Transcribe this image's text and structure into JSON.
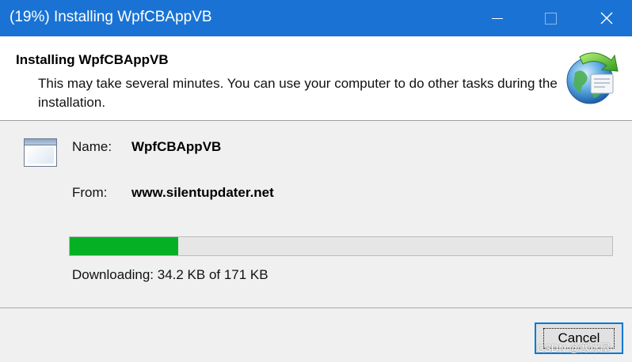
{
  "window": {
    "title": "(19%) Installing WpfCBAppVB",
    "buttons": {
      "minimize": "minimize-icon",
      "maximize": "maximize-icon",
      "close": "close-icon"
    }
  },
  "header": {
    "title": "Installing WpfCBAppVB",
    "description": "This may take several minutes. You can use your computer to do other tasks during the installation.",
    "icon": "globe-install-icon"
  },
  "details": {
    "icon": "application-window-icon",
    "name_label": "Name:",
    "name_value": "WpfCBAppVB",
    "from_label": "From:",
    "from_value": "www.silentupdater.net"
  },
  "progress": {
    "fraction": 0.2,
    "color": "#06b025",
    "status": "Downloading: 34.2 KB of 171 KB"
  },
  "footer": {
    "cancel_label": "Cancel"
  },
  "watermark": "CSDN @寒冰屋",
  "colors": {
    "titlebar": "#1a73d4",
    "button_focus": "#0078d7"
  }
}
